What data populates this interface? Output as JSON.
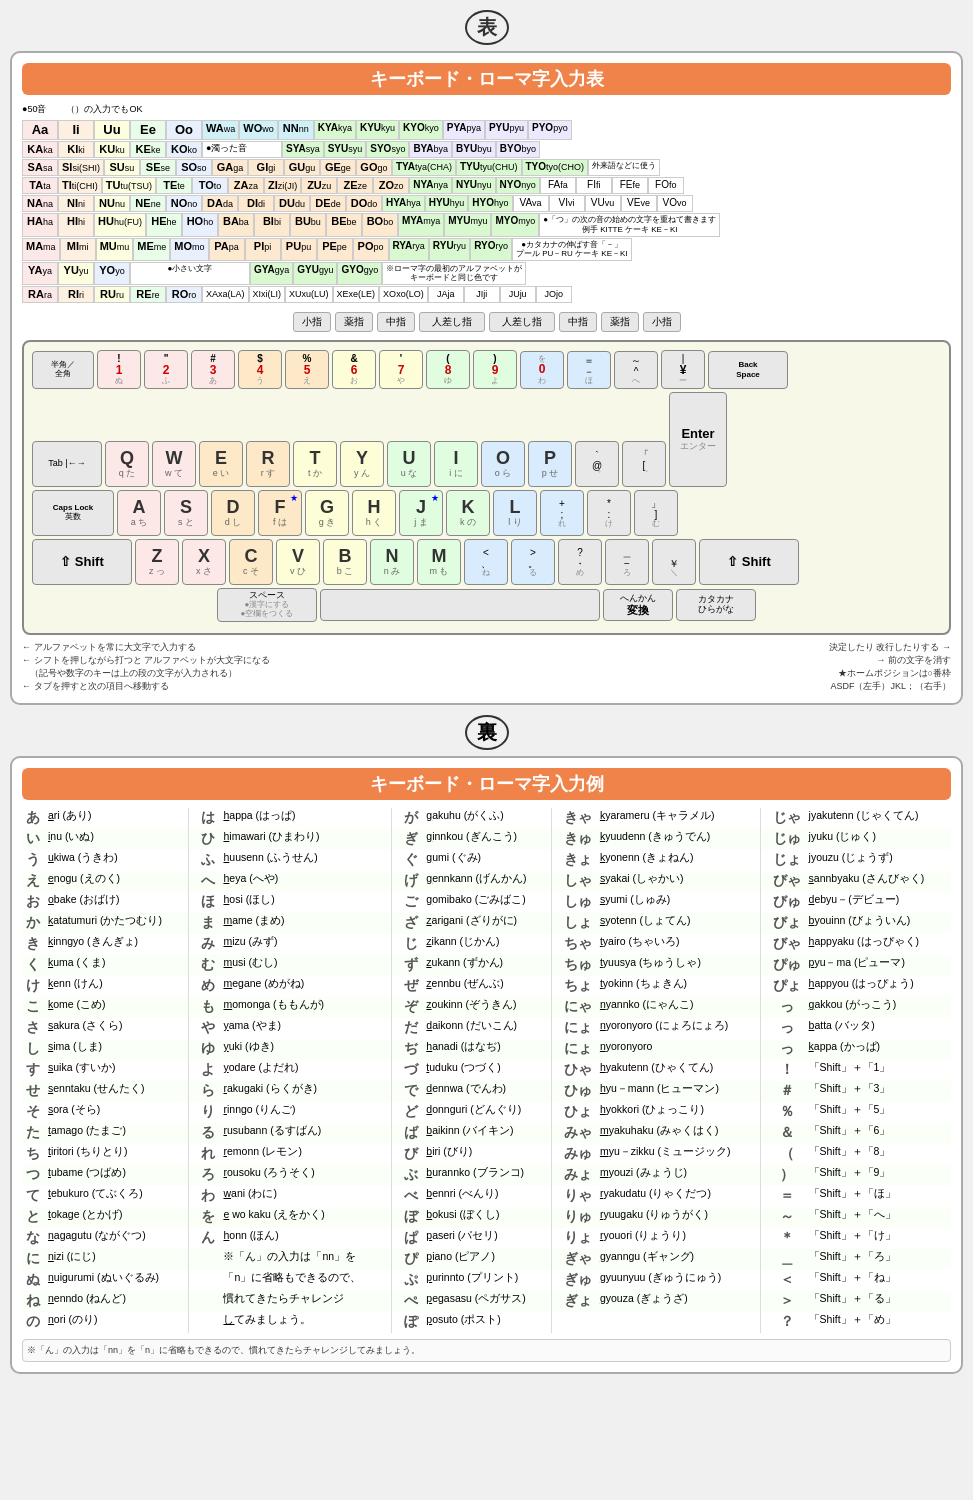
{
  "page": {
    "omote_label": "表",
    "ura_label": "裏",
    "romaji_title": "キーボード・ローマ字入力表",
    "example_title": "キーボード・ローマ字入力例",
    "count_label": "●50音",
    "paren_note": "（）の入力でもOK",
    "backspace_label": "Back\nSpace",
    "enter_label": "Enter",
    "tab_label": "Tab |←→",
    "caps_label": "Caps Lock\n英数",
    "shift_label": "⇧ Shift"
  },
  "romaji_rows": [
    [
      {
        "bg": "pink",
        "big": "Aa",
        "small": ""
      },
      {
        "bg": "orange",
        "big": "Ii",
        "small": ""
      },
      {
        "bg": "yellow",
        "big": "Uu",
        "small": ""
      },
      {
        "bg": "green",
        "big": "Ee",
        "small": ""
      },
      {
        "bg": "blue",
        "big": "Oo",
        "small": ""
      },
      {
        "bg": "white",
        "big": "WA",
        "small": "wa"
      },
      {
        "bg": "white",
        "big": "WO",
        "small": "wo"
      },
      {
        "bg": "white",
        "big": "NN",
        "small": "nn"
      },
      {
        "bg": "white",
        "big": "KYA",
        "small": "kya"
      },
      {
        "bg": "white",
        "big": "KYU",
        "small": "kyu"
      },
      {
        "bg": "white",
        "big": "KYO",
        "small": "kyo"
      },
      {
        "bg": "lavender",
        "big": "PYA",
        "small": "pya"
      },
      {
        "bg": "lavender",
        "big": "PYU",
        "small": "pyu"
      },
      {
        "bg": "lavender",
        "big": "PYO",
        "small": "pyo"
      }
    ]
  ],
  "finger_labels": [
    "小指",
    "薬指",
    "中指",
    "人差し指",
    "人差し指",
    "中指",
    "薬指",
    "小指"
  ],
  "keyboard_rows": {
    "number_row": [
      "半角/全角",
      "1ぬ",
      "2ふ",
      "3あ",
      "4う",
      "5え",
      "6お",
      "7や",
      "8ゆ",
      "9よ",
      "0わ",
      "ほ",
      "へ",
      "¥",
      "BackSpace"
    ],
    "q_row": [
      "Tab",
      "Q",
      "W",
      "E",
      "R",
      "T",
      "Y",
      "U",
      "I",
      "O",
      "P",
      "@",
      "[",
      "Enter"
    ],
    "a_row": [
      "CapsLock",
      "A",
      "S",
      "D",
      "F",
      "G",
      "H",
      "J",
      "K",
      "L",
      ";",
      ":",
      "」"
    ],
    "z_row": [
      "Shift",
      "Z",
      "X",
      "C",
      "V",
      "B",
      "N",
      "M",
      "、",
      "。",
      "・",
      "ろ",
      "Shift"
    ]
  },
  "examples": [
    {
      "kana": "あ",
      "roman": "ari (あり)",
      "kana2": "は",
      "roman2": "happa (はっぱ)",
      "kana3": "が",
      "roman3": "gakuhu (がくふ)",
      "kana4": "きゃ",
      "roman4": "kyarameru (キャラメル)",
      "kana5": "じゃ",
      "roman5": "jyakutenn (じゃくてん)"
    },
    {
      "kana": "い",
      "roman": "inu (いぬ)",
      "kana2": "ひ",
      "roman2": "himawari (ひまわり)",
      "kana3": "ぎ",
      "roman3": "ginnkou (ぎんこう)",
      "kana4": "きゅ",
      "roman4": "kyuudenn (きゅうでん)",
      "kana5": "じゅ",
      "roman5": "jyuku (じゅく)"
    },
    {
      "kana": "う",
      "roman": "ukiwa (うきわ)",
      "kana2": "ふ",
      "roman2": "huusenn (ふうせん)",
      "kana3": "ぐ",
      "roman3": "gumi (ぐみ)",
      "kana4": "きょ",
      "roman4": "kyonenn (きょねん)",
      "kana5": "じょ",
      "roman5": "jyouzu (じょうず)"
    },
    {
      "kana": "え",
      "roman": "enogu (えのく)",
      "kana2": "へ",
      "roman2": "heya (へや)",
      "kana3": "げ",
      "roman3": "gennkann (げんかん)",
      "kana4": "しゃ",
      "roman4": "syakai (しゃかい)",
      "kana5": "びゃ",
      "roman5": "sannbyaku (さんびゃく)"
    },
    {
      "kana": "お",
      "roman": "obake (おばけ)",
      "kana2": "ほ",
      "roman2": "hosi (ほし)",
      "kana3": "ご",
      "roman3": "gomibako (ごみばこ)",
      "kana4": "しゅ",
      "roman4": "syumi (しゅみ)",
      "kana5": "びゅ",
      "roman5": "debyu－(デビュー)"
    },
    {
      "kana": "か",
      "roman": "katatumuri (かたつむり)",
      "kana2": "ま",
      "roman2": "mame (まめ)",
      "kana3": "ざ",
      "roman3": "zarigani (ざりがに)",
      "kana4": "しょ",
      "roman4": "syotenn (しょてん)",
      "kana5": "びょ",
      "roman5": "byouinn (びょういん)"
    },
    {
      "kana": "き",
      "roman": "kinngyo (きんぎょ)",
      "kana2": "み",
      "roman2": "mizu (みず)",
      "kana3": "じ",
      "roman3": "zikann (じかん)",
      "kana4": "ちゃ",
      "roman4": "tyairo (ちゃいろ)",
      "kana5": "びゃ",
      "roman5": "happyaku (はっぴゃく)"
    },
    {
      "kana": "く",
      "roman": "kuma (くま)",
      "kana2": "む",
      "roman2": "musi (むし)",
      "kana3": "ず",
      "roman3": "zukann (ずかん)",
      "kana4": "ちゅ",
      "roman4": "tyuusya (ちゅうしゃ)",
      "kana5": "ぴゅ",
      "roman5": "pyu－ma (ピューマ)"
    },
    {
      "kana": "け",
      "roman": "kenn (けん)",
      "kana2": "め",
      "roman2": "megane (めがね)",
      "kana3": "ぜ",
      "roman3": "zennbu (ぜんぶ)",
      "kana4": "ちょ",
      "roman4": "tyokinn (ちょきん)",
      "kana5": "ぴょ",
      "roman5": "happyou (はっぴょう)"
    },
    {
      "kana": "こ",
      "roman": "kome (こめ)",
      "kana2": "も",
      "roman2": "momonga (ももんが)",
      "kana3": "ぞ",
      "roman3": "zoukinn (ぞうきん)",
      "kana4": "にゃ",
      "roman4": "nyannko (にゃんこ)",
      "kana5": "っ",
      "roman5": "gakkou (がっこう)"
    },
    {
      "kana": "さ",
      "roman": "sakura (さくら)",
      "kana2": "や",
      "roman2": "yama (やま)",
      "kana3": "だ",
      "roman3": "daikonn (だいこん)",
      "kana4": "にょ",
      "roman4": "nyoronyoro (にょろにょろ)",
      "kana5": "っ",
      "roman5": "batta (バッタ)"
    },
    {
      "kana": "し",
      "roman": "sima (しま)",
      "kana2": "ゆ",
      "roman2": "yuki (ゆき)",
      "kana3": "ぢ",
      "roman3": "hanadi (はなぢ)",
      "kana4": "にょ",
      "roman4": "nyoronyoro",
      "kana5": "っ",
      "roman5": "kappa (かっぱ)"
    },
    {
      "kana": "す",
      "roman": "suika (すいか)",
      "kana2": "よ",
      "roman2": "yodare (よだれ)",
      "kana3": "づ",
      "roman3": "tuduku (つづく)",
      "kana4": "ひゃ",
      "roman4": "hyakutenn (ひゃくてん)",
      "kana5": "！",
      "roman5": "「Shift」＋「1」"
    },
    {
      "kana": "せ",
      "roman": "senntaku (せんたく)",
      "kana2": "ら",
      "roman2": "rakugaki (らくがき)",
      "kana3": "で",
      "roman3": "dennwa (でんわ)",
      "kana4": "ひゅ",
      "roman4": "hyu－mann (ヒューマン)",
      "kana5": "＃",
      "roman5": "「Shift」＋「3」"
    },
    {
      "kana": "そ",
      "roman": "sora (そら)",
      "kana2": "り",
      "roman2": "rinngo (りんご)",
      "kana3": "ど",
      "roman3": "donnguri (どんぐり)",
      "kana4": "ひょ",
      "roman4": "hyokkori (ひょっこり)",
      "kana5": "％",
      "roman5": "「Shift」＋「5」"
    },
    {
      "kana": "た",
      "roman": "tamago (たまご)",
      "kana2": "る",
      "roman2": "rusubann (るすばん)",
      "kana3": "ば",
      "roman3": "baikinn (バイキン)",
      "kana4": "みゃ",
      "roman4": "myakuhaku (みゃくはく)",
      "kana5": "＆",
      "roman5": "「Shift」＋「6」"
    },
    {
      "kana": "ち",
      "roman": "tiritori (ちりとり)",
      "kana2": "れ",
      "roman2": "remonn (レモン)",
      "kana3": "び",
      "roman3": "biri (びり)",
      "kana4": "みゅ",
      "roman4": "myu－zikku (ミュージック)",
      "kana5": "（",
      "roman5": "「Shift」＋「8」"
    },
    {
      "kana": "つ",
      "roman": "tubame (つばめ)",
      "kana2": "ろ",
      "roman2": "rousoku (ろうそく)",
      "kana3": "ぶ",
      "roman3": "burannko (ブランコ)",
      "kana4": "みょ",
      "roman4": "myouzi (みょうじ)",
      "kana5": "）",
      "roman5": "「Shift」＋「9」"
    },
    {
      "kana": "て",
      "roman": "tebukuro (てぶくろ)",
      "kana2": "わ",
      "roman2": "wani (わに)",
      "kana3": "べ",
      "roman3": "bennri (べんり)",
      "kana4": "りゃ",
      "roman4": "ryakudatu (りゃくだつ)",
      "kana5": "＝",
      "roman5": "「Shift」＋「ほ」"
    },
    {
      "kana": "と",
      "roman": "tokage (とかげ)",
      "kana2": "を",
      "roman2": "e wo kaku (えをかく)",
      "kana3": "ぼ",
      "roman3": "bokusi (ぼくし)",
      "kana4": "りゅ",
      "roman4": "ryuugaku (りゅうがく)",
      "kana5": "～",
      "roman5": "「Shift」＋「へ」"
    },
    {
      "kana": "な",
      "roman": "nagagutu (ながぐつ)",
      "kana2": "ん",
      "roman2": "honn (ほん)",
      "kana3": "ぱ",
      "roman3": "paseri (パセリ)",
      "kana4": "りょ",
      "roman4": "ryouori (りょうり)",
      "kana5": "＊",
      "roman5": "「Shift」＋「け」"
    },
    {
      "kana": "に",
      "roman": "nizi (にじ)",
      "kana2": "",
      "roman2": "※「ん」の入力は「nn」を",
      "kana3": "ぴ",
      "roman3": "piano (ピアノ)",
      "kana4": "ぎゃ",
      "roman4": "gyanngu (ギャング)",
      "kana5": "＿",
      "roman5": "「Shift」＋「ろ」"
    },
    {
      "kana": "ぬ",
      "roman": "nuigurumi (ぬいぐるみ)",
      "kana2": "",
      "roman2": "「n」に省略もできるので、",
      "kana3": "ぷ",
      "roman3": "purinnto (プリント)",
      "kana4": "ぎゅ",
      "roman4": "gyuunyuu (ぎゅうにゅう)",
      "kana5": "＜",
      "roman5": "「Shift」＋「ね」"
    },
    {
      "kana": "ね",
      "roman": "nenndo (ねんど)",
      "kana2": "",
      "roman2": "慣れてきたらチャレンジ",
      "kana3": "ぺ",
      "roman3": "pegasasu (ペガサス)",
      "kana4": "ぎょ",
      "roman4": "gyouza (ぎょうざ)",
      "kana5": "＞",
      "roman5": "「Shift」＋「る」"
    },
    {
      "kana": "の",
      "roman": "nori (のり)",
      "kana2": "",
      "roman2": "してみましょう。",
      "kana3": "ぽ",
      "roman3": "posuto (ポスト)",
      "kana4": "",
      "roman4": "",
      "kana5": "？",
      "roman5": "「Shift」＋「め」"
    }
  ]
}
